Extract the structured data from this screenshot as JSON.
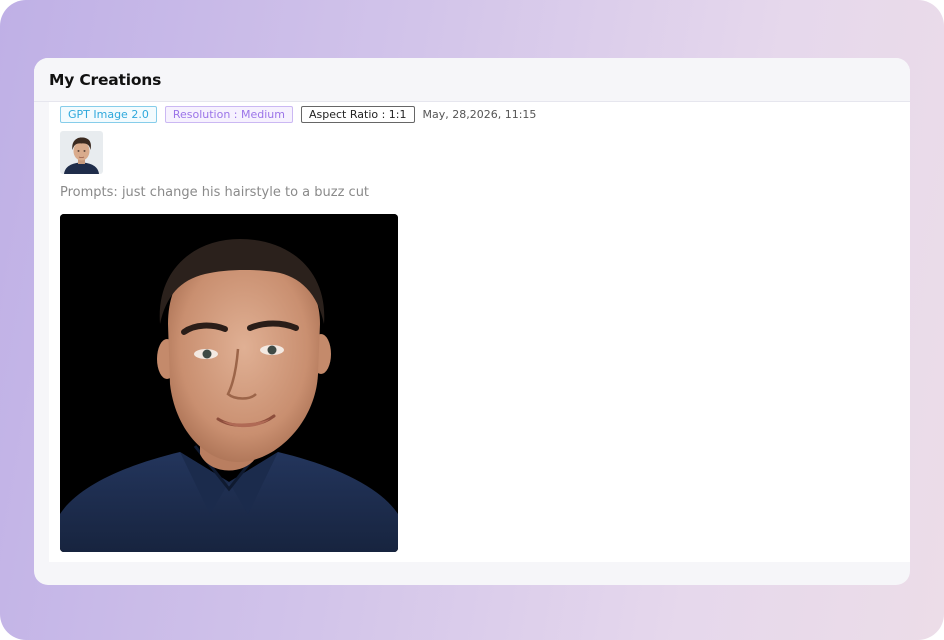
{
  "panel": {
    "title": "My Creations"
  },
  "creation": {
    "tags": {
      "model": "GPT Image 2.0",
      "resolution": "Resolution : Medium",
      "aspect_ratio": "Aspect Ratio : 1:1"
    },
    "timestamp": "May, 28,2026, 11:15",
    "prompt_label": "Prompts:",
    "prompt_text": "just change his hairstyle to a buzz cut",
    "input_thumbnail_icon": "person-photo-icon",
    "result_image_icon": "person-portrait-image"
  },
  "colors": {
    "model_tag": "#2fa9dc",
    "resolution_tag": "#9b74e8",
    "aspect_tag": "#222222",
    "frame_gradient_start": "#bfb0e6",
    "frame_gradient_end": "#ecdde8"
  }
}
